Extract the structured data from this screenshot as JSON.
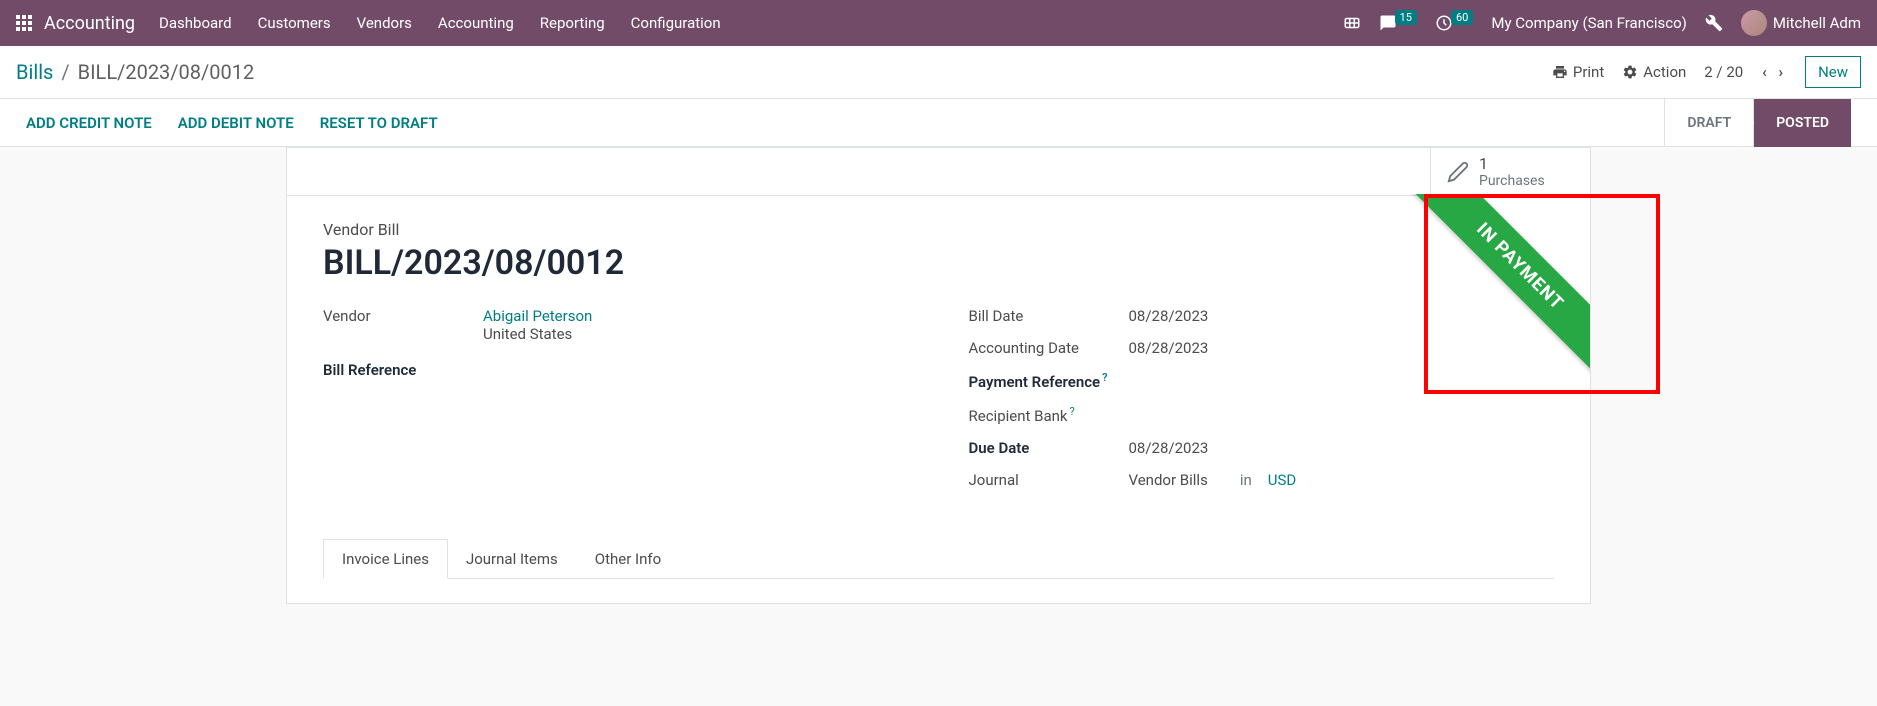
{
  "topbar": {
    "brand": "Accounting",
    "menu": [
      "Dashboard",
      "Customers",
      "Vendors",
      "Accounting",
      "Reporting",
      "Configuration"
    ],
    "messages_badge": "15",
    "activities_badge": "60",
    "company": "My Company (San Francisco)",
    "user": "Mitchell Adm"
  },
  "breadcrumb": {
    "root": "Bills",
    "current": "BILL/2023/08/0012"
  },
  "control_panel": {
    "print": "Print",
    "action": "Action",
    "pager": "2 / 20",
    "new_btn": "New"
  },
  "statusbar": {
    "actions": [
      "ADD CREDIT NOTE",
      "ADD DEBIT NOTE",
      "RESET TO DRAFT"
    ],
    "steps": {
      "draft": "DRAFT",
      "posted": "POSTED"
    }
  },
  "stat_button": {
    "count": "1",
    "label": "Purchases"
  },
  "ribbon": "IN PAYMENT",
  "form": {
    "doc_type": "Vendor Bill",
    "title": "BILL/2023/08/0012",
    "left": {
      "vendor_label": "Vendor",
      "vendor_name": "Abigail Peterson",
      "vendor_country": "United States",
      "bill_ref_label": "Bill Reference"
    },
    "right": {
      "bill_date_label": "Bill Date",
      "bill_date": "08/28/2023",
      "acc_date_label": "Accounting Date",
      "acc_date": "08/28/2023",
      "pay_ref_label": "Payment Reference",
      "recip_bank_label": "Recipient Bank",
      "due_date_label": "Due Date",
      "due_date": "08/28/2023",
      "journal_label": "Journal",
      "journal": "Vendor Bills",
      "journal_in": "in",
      "journal_cur": "USD"
    }
  },
  "tabs": [
    "Invoice Lines",
    "Journal Items",
    "Other Info"
  ]
}
